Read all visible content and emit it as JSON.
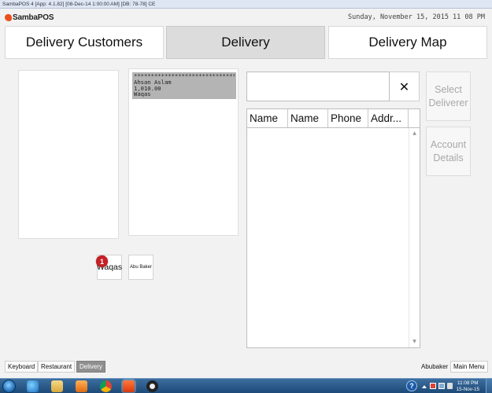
{
  "window": {
    "title": "SambaPOS 4 [App: 4.1.82] [08-Dec-14 1:00:00 AM] [DB: 78-78] CE"
  },
  "header": {
    "logo_text": "SambaPOS",
    "datetime": "Sunday, November 15, 2015 11 08 PM"
  },
  "nav": {
    "delivery_customers": "Delivery Customers",
    "delivery": "Delivery",
    "delivery_map": "Delivery Map",
    "active": "Delivery"
  },
  "ticket": {
    "stars": "******************************************",
    "customer": "Ahsan Aslam",
    "amount": "1,010.00",
    "deliverer": "Waqas"
  },
  "deliverers": [
    {
      "name": "Waqas",
      "badge": "1"
    },
    {
      "name": "Abu Baker"
    }
  ],
  "search": {
    "value": "",
    "clear_icon": "✕"
  },
  "grid": {
    "columns": [
      "Name",
      "Name",
      "Phone",
      "Addr..."
    ],
    "scroll_up": "▲",
    "scroll_down": "▼"
  },
  "actions": {
    "select_deliverer": "Select\nDeliverer",
    "account_details": "Account\nDetails"
  },
  "footer": {
    "keyboard": "Keyboard",
    "restaurant": "Restaurant",
    "delivery": "Delivery",
    "user": "Abubaker",
    "main_menu": "Main Menu"
  },
  "taskbar": {
    "icons": [
      "start-orb-icon",
      "ie-icon",
      "explorer-folder-icon",
      "media-player-icon",
      "chrome-icon",
      "sambapos-icon",
      "steam-icon"
    ],
    "help": "?",
    "time": "11:08 PM",
    "date": "15-Nov-15"
  },
  "colors": {
    "badge": "#c42025",
    "active_nav": "#dcdcdc",
    "ticket_bg": "#b4b4b4",
    "taskbar": "#1d4a78"
  }
}
